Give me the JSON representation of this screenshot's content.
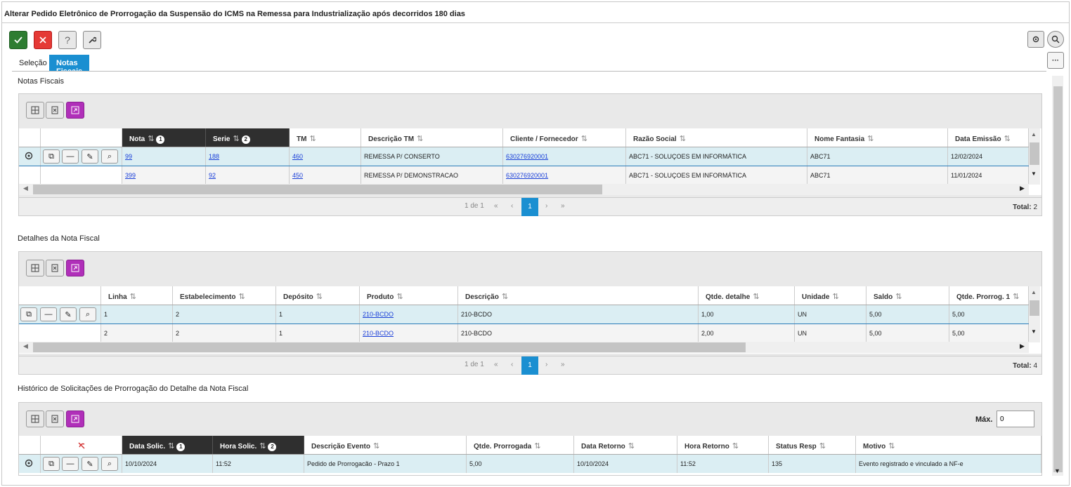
{
  "window": {
    "title": "Alterar Pedido Eletrônico de Prorrogação da Suspensão do ICMS na Remessa para Industrialização após decorridos 180 dias"
  },
  "toolbar": {
    "confirm_icon": "check-icon",
    "cancel_icon": "x-icon",
    "help_label": "?",
    "tools_icon": "wrench-icon",
    "settings_icon": "gear-icon",
    "search_icon": "search-icon",
    "more_label": "···"
  },
  "tabs": [
    {
      "label": "Seleção",
      "active": false
    },
    {
      "label": "Notas Fiscais",
      "active": true
    }
  ],
  "colors": {
    "accent": "#1a8fd1",
    "confirm": "#2e7d32",
    "cancel": "#e53935",
    "purple": "#b02fb9",
    "dark_header": "#2f2f2f",
    "selected_row": "#dbeef3"
  },
  "notas": {
    "section_title": "Notas Fiscais",
    "columns": [
      "Nota",
      "Serie",
      "TM",
      "Descrição TM",
      "Cliente / Fornecedor",
      "Razão Social",
      "Nome Fantasia",
      "Data Emissão"
    ],
    "sort_badges": [
      "1",
      "2"
    ],
    "rows": [
      [
        "99",
        "188",
        "460",
        "REMESSA P/ CONSERTO",
        "630276920001",
        "ABC71 - SOLUÇOES EM INFORMÁTICA",
        "ABC71",
        "12/02/2024"
      ],
      [
        "399",
        "92",
        "450",
        "REMESSA P/ DEMONSTRACAO",
        "630276920001",
        "ABC71 - SOLUÇOES EM INFORMÁTICA",
        "ABC71",
        "11/01/2024"
      ]
    ],
    "pager": {
      "info": "1 de 1",
      "first": "«",
      "prev": "‹",
      "page": "1",
      "next": "›",
      "last": "»",
      "total_label": "Total:",
      "total": "2"
    }
  },
  "detalhes": {
    "section_title": "Detalhes da Nota Fiscal",
    "columns": [
      "Linha",
      "Estabelecimento",
      "Depósito",
      "Produto",
      "Descrição",
      "Qtde. detalhe",
      "Unidade",
      "Saldo",
      "Qtde. Prorrog. 1"
    ],
    "rows": [
      [
        "1",
        "2",
        "1",
        "210-BCDO",
        "210-BCDO",
        "1,00",
        "UN",
        "5,00",
        "5,00"
      ],
      [
        "2",
        "2",
        "1",
        "210-BCDO",
        "210-BCDO",
        "2,00",
        "UN",
        "5,00",
        "5,00"
      ]
    ],
    "pager": {
      "info": "1 de 1",
      "first": "«",
      "prev": "‹",
      "page": "1",
      "next": "›",
      "last": "»",
      "total_label": "Total:",
      "total": "4"
    }
  },
  "historico": {
    "section_title": "Histórico de Solicitações de Prorrogação do Detalhe da Nota Fiscal",
    "max_label": "Máx.",
    "max_value": "0",
    "columns": [
      "Data Solic.",
      "Hora Solic.",
      "Descrição Evento",
      "Qtde. Prorrogada",
      "Data Retorno",
      "Hora Retorno",
      "Status Resp",
      "Motivo"
    ],
    "sort_badges": [
      "1",
      "2"
    ],
    "rows": [
      [
        "10/10/2024",
        "11:52",
        "Pedido de Prorrogacão - Prazo 1",
        "5,00",
        "10/10/2024",
        "11:52",
        "135",
        "Evento registrado e vinculado a NF-e"
      ]
    ]
  }
}
